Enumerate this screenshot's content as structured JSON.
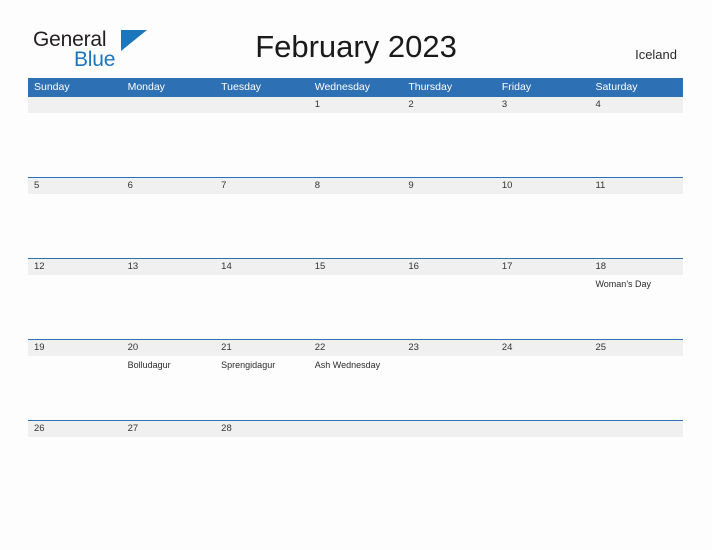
{
  "brand": {
    "name_part1": "General",
    "name_part2": "Blue",
    "flag_icon": "blue-flag-triangle-icon",
    "accent_color": "#1b76bc"
  },
  "header": {
    "title": "February 2023",
    "country": "Iceland"
  },
  "theme": {
    "header_blue": "#2e70b4",
    "date_strip_gray": "#f0f0f0",
    "page_background": "#fdfdfd",
    "text_color": "#333333"
  },
  "calendar": {
    "weekdays": [
      "Sunday",
      "Monday",
      "Tuesday",
      "Wednesday",
      "Thursday",
      "Friday",
      "Saturday"
    ],
    "weeks": [
      {
        "days": [
          {
            "date": "",
            "event": ""
          },
          {
            "date": "",
            "event": ""
          },
          {
            "date": "",
            "event": ""
          },
          {
            "date": "1",
            "event": ""
          },
          {
            "date": "2",
            "event": ""
          },
          {
            "date": "3",
            "event": ""
          },
          {
            "date": "4",
            "event": ""
          }
        ]
      },
      {
        "days": [
          {
            "date": "5",
            "event": ""
          },
          {
            "date": "6",
            "event": ""
          },
          {
            "date": "7",
            "event": ""
          },
          {
            "date": "8",
            "event": ""
          },
          {
            "date": "9",
            "event": ""
          },
          {
            "date": "10",
            "event": ""
          },
          {
            "date": "11",
            "event": ""
          }
        ]
      },
      {
        "days": [
          {
            "date": "12",
            "event": ""
          },
          {
            "date": "13",
            "event": ""
          },
          {
            "date": "14",
            "event": ""
          },
          {
            "date": "15",
            "event": ""
          },
          {
            "date": "16",
            "event": ""
          },
          {
            "date": "17",
            "event": ""
          },
          {
            "date": "18",
            "event": "Woman's Day"
          }
        ]
      },
      {
        "days": [
          {
            "date": "19",
            "event": ""
          },
          {
            "date": "20",
            "event": "Bolludagur"
          },
          {
            "date": "21",
            "event": "Sprengidagur"
          },
          {
            "date": "22",
            "event": "Ash Wednesday"
          },
          {
            "date": "23",
            "event": ""
          },
          {
            "date": "24",
            "event": ""
          },
          {
            "date": "25",
            "event": ""
          }
        ]
      },
      {
        "days": [
          {
            "date": "26",
            "event": ""
          },
          {
            "date": "27",
            "event": ""
          },
          {
            "date": "28",
            "event": ""
          },
          {
            "date": "",
            "event": ""
          },
          {
            "date": "",
            "event": ""
          },
          {
            "date": "",
            "event": ""
          },
          {
            "date": "",
            "event": ""
          }
        ]
      }
    ]
  }
}
